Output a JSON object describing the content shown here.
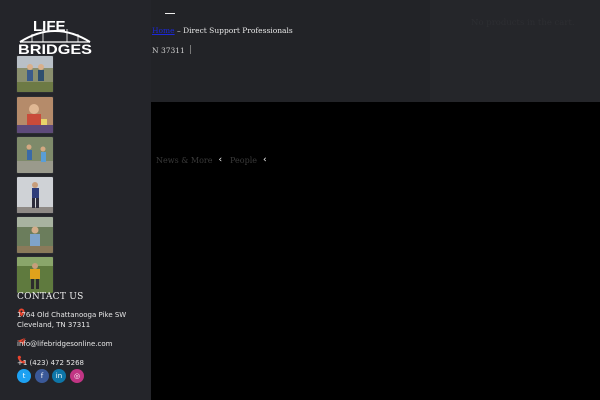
{
  "header": {
    "cart_text": "No products in the cart.",
    "breadcrumb": {
      "link_label": "Home",
      "separator": " – ",
      "current": "Direct Support Professionals"
    },
    "partial_address": "N 37311"
  },
  "main": {
    "nav_items": [
      {
        "label": "News & More",
        "icon": "chevron-left-icon"
      },
      {
        "label": "People",
        "icon": "chevron-left-icon"
      }
    ]
  },
  "sidebar": {
    "logo": {
      "line1": "LIFE",
      "line2": "BRIDGES"
    },
    "photos": [
      {
        "alt": "Two people standing outdoors in a field"
      },
      {
        "alt": "Person seated at a table indoors"
      },
      {
        "alt": "People walking outside together"
      },
      {
        "alt": "Person standing indoors in front of a wall"
      },
      {
        "alt": "Person outdoors near trees"
      },
      {
        "alt": "Person in yellow shirt on a lawn"
      }
    ],
    "contact": {
      "title": "CONTACT US",
      "address_line1": "1764 Old Chattanooga Pike SW",
      "address_line2": "Cleveland, TN 37311",
      "email": "info@lifebridgesonline.com",
      "phone": "+1 (423) 472 5268"
    },
    "social": [
      {
        "name": "twitter",
        "icon": "twitter-icon",
        "color": "#1da1f2"
      },
      {
        "name": "facebook",
        "icon": "facebook-icon",
        "color": "#3b5998"
      },
      {
        "name": "linkedin",
        "icon": "linkedin-icon",
        "color": "#0e76a8"
      },
      {
        "name": "instagram",
        "icon": "instagram-icon",
        "color": "#c13584"
      }
    ]
  },
  "colors": {
    "accent_icon": "#e8442e",
    "sidebar_bg": "#24252a",
    "topbar_bg": "#222327",
    "link": "#1b28d8"
  }
}
